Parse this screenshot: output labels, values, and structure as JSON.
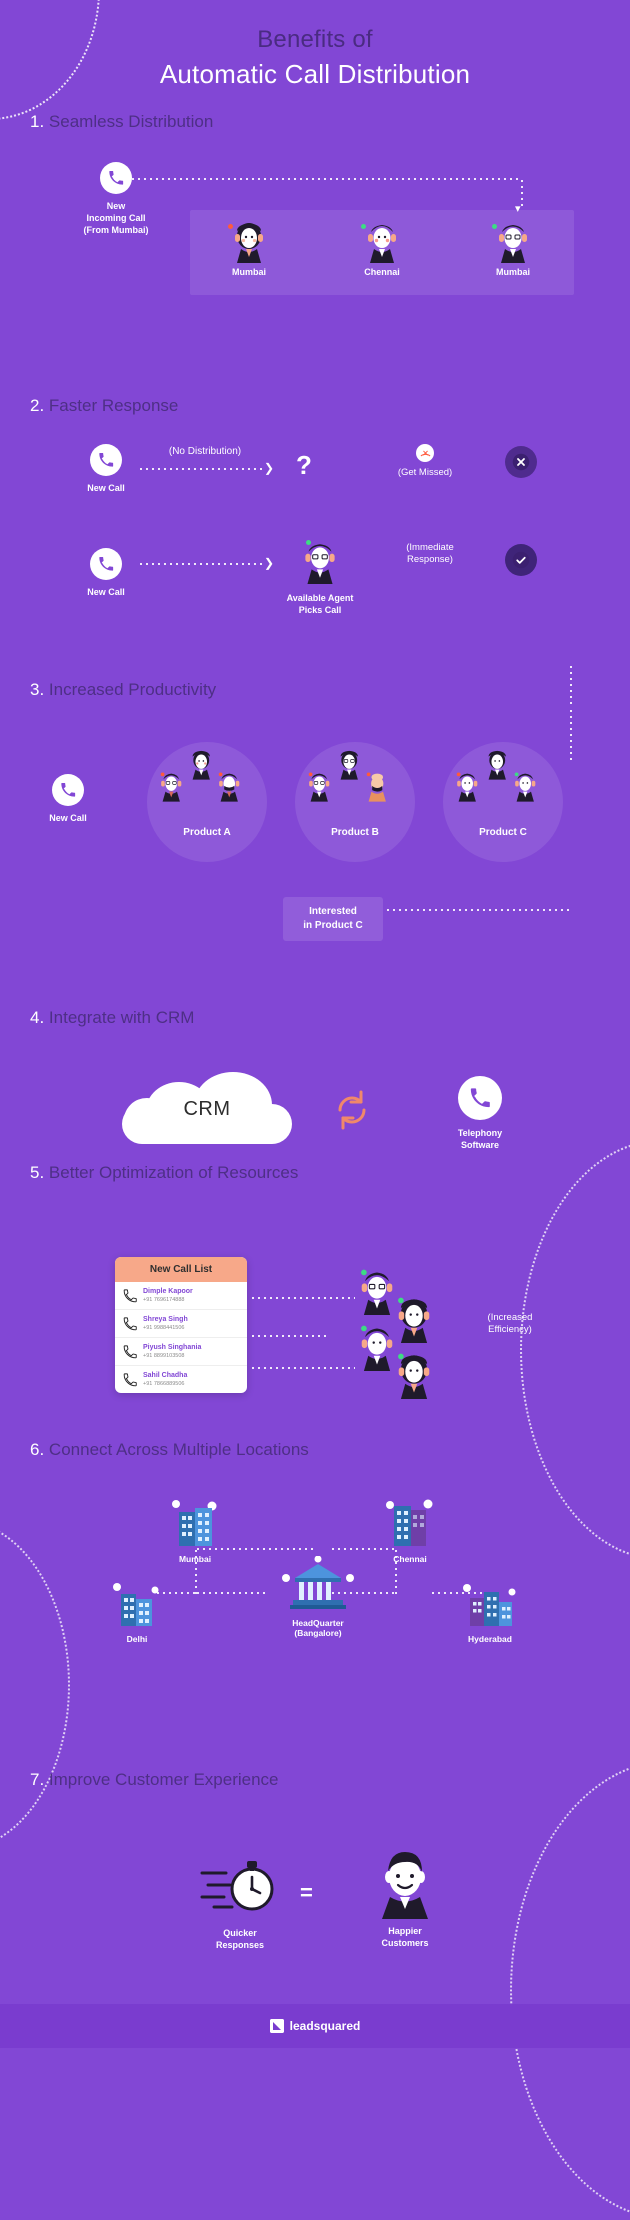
{
  "header": {
    "line1": "Benefits of",
    "line2": "Automatic Call Distribution"
  },
  "colors": {
    "background": "#8247d5",
    "heading": "#4e2f86",
    "accent_white": "#ffffff",
    "footer_bar": "#7a3ccf",
    "list_header": "#f7a889",
    "name_purple": "#8247d5",
    "status_red": "#ff5a3c",
    "status_green": "#3ddc84"
  },
  "sections": [
    {
      "number": "1.",
      "title": "Seamless Distribution",
      "source": {
        "icon": "phone-icon",
        "label_lines": [
          "New",
          "Incoming Call",
          "(From Mumbai)"
        ]
      },
      "agents": [
        {
          "name": "Mumbai",
          "status": "busy"
        },
        {
          "name": "Chennai",
          "status": "available"
        },
        {
          "name": "Mumbai",
          "status": "available"
        }
      ]
    },
    {
      "number": "2.",
      "title": "Faster Response",
      "rows": [
        {
          "call_label": "New Call",
          "flow_label": "(No Distribution)",
          "middle_symbol": "?",
          "result_label": "(Get Missed)",
          "result_icon": "missed-call-icon",
          "badge": "cross-badge"
        },
        {
          "call_label": "New Call",
          "flow_label": "",
          "agent_label_lines": [
            "Available Agent",
            "Picks Call"
          ],
          "result_label_lines": [
            "(Immediate",
            "Response)"
          ],
          "badge": "check-badge"
        }
      ]
    },
    {
      "number": "3.",
      "title": "Increased Productivity",
      "call_label": "New Call",
      "products": [
        {
          "label": "Product A"
        },
        {
          "label": "Product B"
        },
        {
          "label": "Product C"
        }
      ],
      "interest_box_lines": [
        "Interested",
        "in Product C"
      ]
    },
    {
      "number": "4.",
      "title": "Integrate with CRM",
      "cloud_label": "CRM",
      "sync_icon": "sync-arrows-icon",
      "telephony_label_lines": [
        "Telephony",
        "Software"
      ],
      "telephony_icon": "phone-icon"
    },
    {
      "number": "5.",
      "title": "Better Optimization of Resources",
      "list_title": "New Call List",
      "calls": [
        {
          "name": "Dimple Kapoor",
          "phone": "+91 7696174888",
          "direction": "incoming"
        },
        {
          "name": "Shreya Singh",
          "phone": "+91 9988441506",
          "direction": "outgoing"
        },
        {
          "name": "Piyush Singhania",
          "phone": "+91 8899103508",
          "direction": "outgoing"
        },
        {
          "name": "Sahil Chadha",
          "phone": "+91 7866889506",
          "direction": "outgoing"
        }
      ],
      "result_label_lines": [
        "(Increased",
        "Efficiency)"
      ]
    },
    {
      "number": "6.",
      "title": "Connect Across Multiple Locations",
      "headquarter_lines": [
        "HeadQuarter",
        "(Bangalore)"
      ],
      "locations": [
        "Mumbai",
        "Chennai",
        "Delhi",
        "Hyderabad"
      ]
    },
    {
      "number": "7.",
      "title": "Improve Customer Experience",
      "left_label_lines": [
        "Quicker",
        "Responses"
      ],
      "equals": "=",
      "right_label_lines": [
        "Happier",
        "Customers"
      ]
    }
  ],
  "footer": {
    "brand": "leadsquared",
    "logo_icon": "leadsquared-logo-icon"
  }
}
